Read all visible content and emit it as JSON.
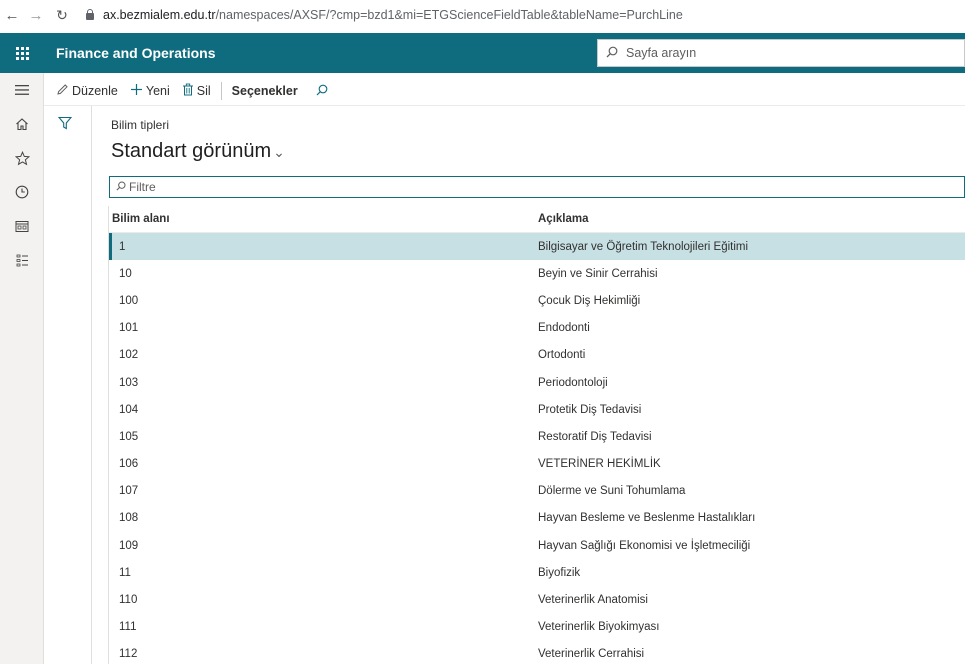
{
  "browser": {
    "url_host": "ax.bezmialem.edu.tr",
    "url_path": "/namespaces/AXSF/?cmp=bzd1&mi=ETGScienceFieldTable&tableName=PurchLine"
  },
  "app": {
    "name": "Finance and Operations",
    "search_placeholder": "Sayfa arayın",
    "brand_color": "#0f6c7f"
  },
  "actions": {
    "edit": "Düzenle",
    "new": "Yeni",
    "delete": "Sil",
    "options": "Seçenekler"
  },
  "page": {
    "caption": "Bilim tipleri",
    "view_name": "Standart görünüm",
    "filter_placeholder": "Filtre"
  },
  "grid": {
    "columns": [
      "Bilim alanı",
      "Açıklama"
    ],
    "rows": [
      {
        "code": "1",
        "desc": "Bilgisayar ve Öğretim Teknolojileri Eğitimi"
      },
      {
        "code": "10",
        "desc": "Beyin ve Sinir Cerrahisi"
      },
      {
        "code": "100",
        "desc": "Çocuk Diş Hekimliği"
      },
      {
        "code": "101",
        "desc": "Endodonti"
      },
      {
        "code": "102",
        "desc": "Ortodonti"
      },
      {
        "code": "103",
        "desc": "Periodontoloji"
      },
      {
        "code": "104",
        "desc": "Protetik Diş Tedavisi"
      },
      {
        "code": "105",
        "desc": "Restoratif Diş Tedavisi"
      },
      {
        "code": "106",
        "desc": "VETERİNER HEKİMLİK"
      },
      {
        "code": "107",
        "desc": "Dölerme ve Suni Tohumlama"
      },
      {
        "code": "108",
        "desc": "Hayvan Besleme ve Beslenme Hastalıkları"
      },
      {
        "code": "109",
        "desc": "Hayvan Sağlığı Ekonomisi ve İşletmeciliği"
      },
      {
        "code": "11",
        "desc": "Biyofizik"
      },
      {
        "code": "110",
        "desc": "Veterinerlik Anatomisi"
      },
      {
        "code": "111",
        "desc": "Veterinerlik Biyokimyası"
      },
      {
        "code": "112",
        "desc": "Veterinerlik Cerrahisi"
      }
    ]
  }
}
